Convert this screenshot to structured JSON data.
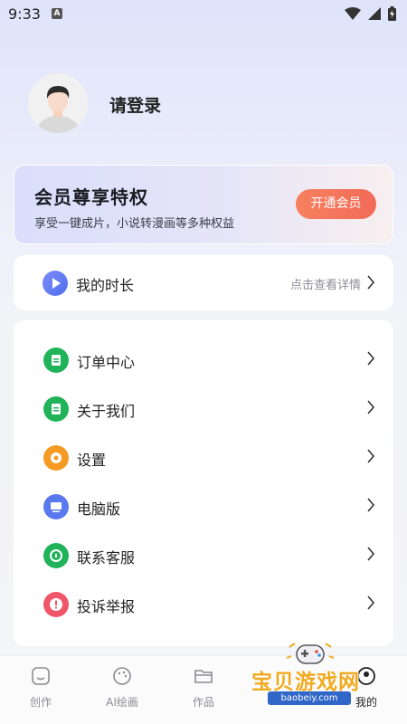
{
  "status_bar": {
    "time": "9:33",
    "notification_letter": "A"
  },
  "profile": {
    "login_text": "请登录"
  },
  "vip": {
    "title": "会员尊享特权",
    "subtitle": "享受一键成片，小说转漫画等多种权益",
    "button_label": "开通会员"
  },
  "duration": {
    "label": "我的时长",
    "detail_label": "点击查看详情"
  },
  "menu": {
    "items": [
      {
        "label": "订单中心",
        "icon": "order-icon",
        "color": "#21b35a"
      },
      {
        "label": "关于我们",
        "icon": "about-icon",
        "color": "#21b35a"
      },
      {
        "label": "设置",
        "icon": "settings-gear-icon",
        "color": "#f59a23"
      },
      {
        "label": "电脑版",
        "icon": "desktop-icon",
        "color": "#5b79ee"
      },
      {
        "label": "联系客服",
        "icon": "customer-service-icon",
        "color": "#21b35a"
      },
      {
        "label": "投诉举报",
        "icon": "complaint-icon",
        "color": "#f0566a"
      }
    ]
  },
  "nav": {
    "items": [
      {
        "label": "创作",
        "icon": "create-icon"
      },
      {
        "label": "AI绘画",
        "icon": "palette-icon"
      },
      {
        "label": "作品",
        "icon": "folder-icon"
      },
      {
        "label": "我的",
        "icon": "profile-icon",
        "active": true
      }
    ]
  },
  "watermark": {
    "text": "宝贝游戏网",
    "url": "baobeiy.com"
  },
  "colors": {
    "accent": "#f26a58",
    "primary_blue": "#4f6ef0"
  }
}
